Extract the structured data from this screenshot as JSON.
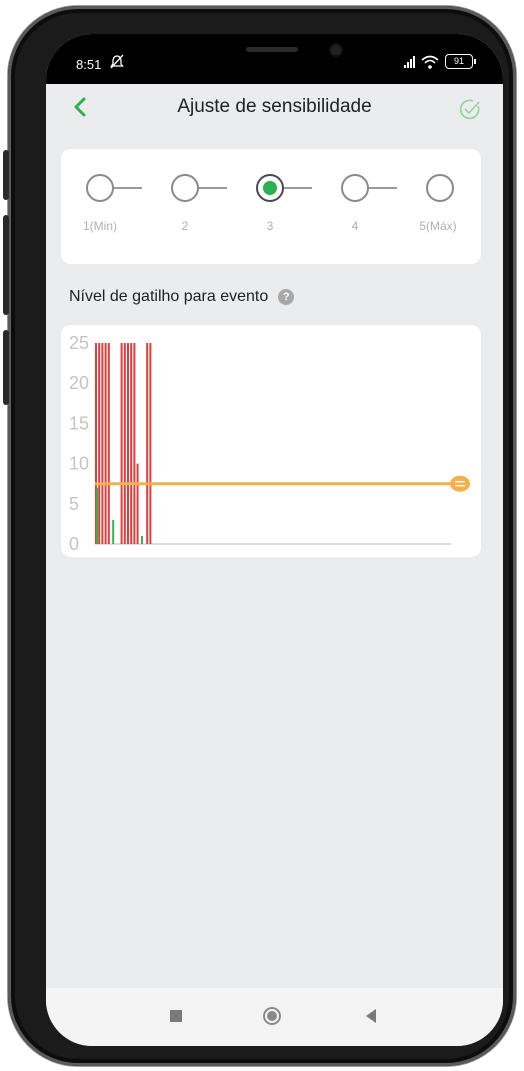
{
  "status_bar": {
    "time": "8:51",
    "battery": "91"
  },
  "header": {
    "title": "Ajuste de sensibilidade"
  },
  "sensitivity": {
    "selected": 3,
    "levels": [
      "1(Min)",
      "2",
      "3",
      "4",
      "5(Máx)"
    ]
  },
  "section": {
    "label": "Nível de gatilho para evento",
    "help": "?"
  },
  "chart_data": {
    "type": "bar",
    "y_ticks": [
      "25",
      "20",
      "15",
      "10",
      "5",
      "0"
    ],
    "ylim": [
      0,
      25
    ],
    "threshold": 7.5,
    "threshold_color": "#f2b24a",
    "series": [
      {
        "color": "#e23d3d",
        "values": [
          25,
          25,
          25,
          25,
          25,
          0,
          0,
          0,
          25,
          25,
          25,
          25,
          25,
          10,
          0,
          0,
          25,
          25
        ]
      },
      {
        "color": "#36b24f",
        "values": [
          7,
          0,
          0,
          0,
          0,
          3,
          0,
          0,
          0,
          0,
          0,
          0,
          0,
          0,
          1,
          0,
          0,
          0
        ]
      }
    ]
  },
  "colors": {
    "accent": "#2bb24c",
    "background": "#ebeced"
  }
}
